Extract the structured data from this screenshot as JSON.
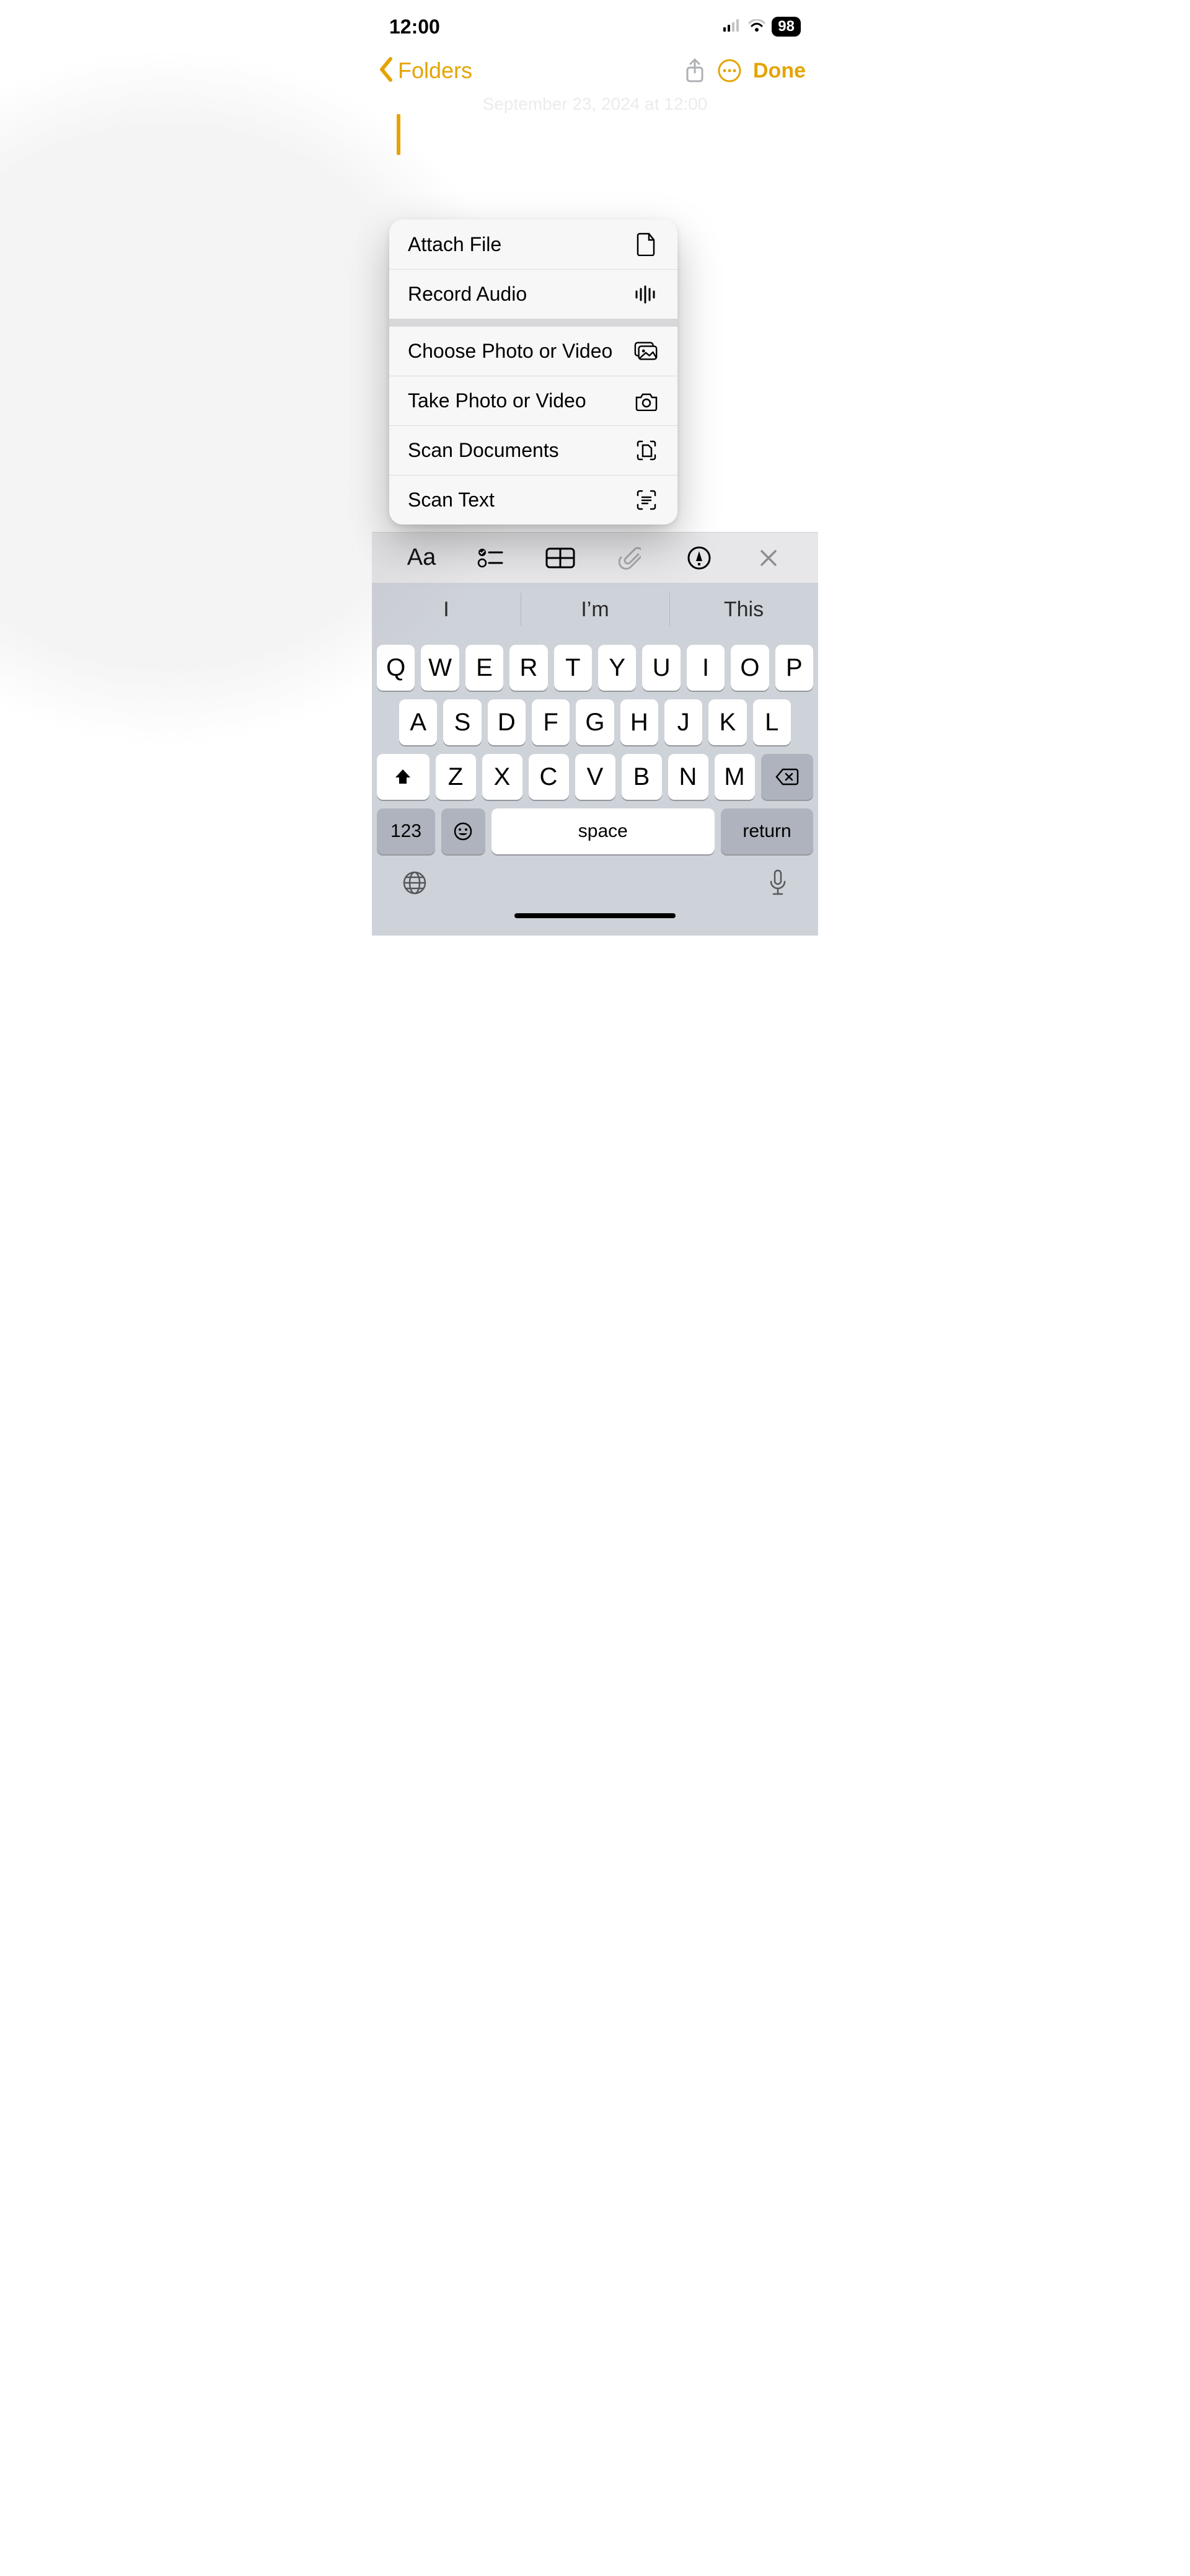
{
  "status_bar": {
    "time": "12:00",
    "battery": "98"
  },
  "nav": {
    "back_label": "Folders",
    "done_label": "Done"
  },
  "note": {
    "ghost_date": "September 23, 2024 at 12:00"
  },
  "attach_menu": {
    "group1": [
      {
        "label": "Attach File",
        "icon": "file-icon"
      },
      {
        "label": "Record Audio",
        "icon": "waveform-icon"
      }
    ],
    "group2": [
      {
        "label": "Choose Photo or Video",
        "icon": "photo-stack-icon"
      },
      {
        "label": "Take Photo or Video",
        "icon": "camera-icon"
      },
      {
        "label": "Scan Documents",
        "icon": "scan-doc-icon"
      },
      {
        "label": "Scan Text",
        "icon": "scan-text-icon"
      }
    ]
  },
  "format_row": {
    "items": [
      "text-format",
      "checklist",
      "table",
      "attachment",
      "markup",
      "close"
    ]
  },
  "keyboard": {
    "suggestions": [
      "I",
      "I’m",
      "This"
    ],
    "row1": [
      "Q",
      "W",
      "E",
      "R",
      "T",
      "Y",
      "U",
      "I",
      "O",
      "P"
    ],
    "row2": [
      "A",
      "S",
      "D",
      "F",
      "G",
      "H",
      "J",
      "K",
      "L"
    ],
    "row3": [
      "Z",
      "X",
      "C",
      "V",
      "B",
      "N",
      "M"
    ],
    "num_key": "123",
    "space_key": "space",
    "return_key": "return"
  }
}
